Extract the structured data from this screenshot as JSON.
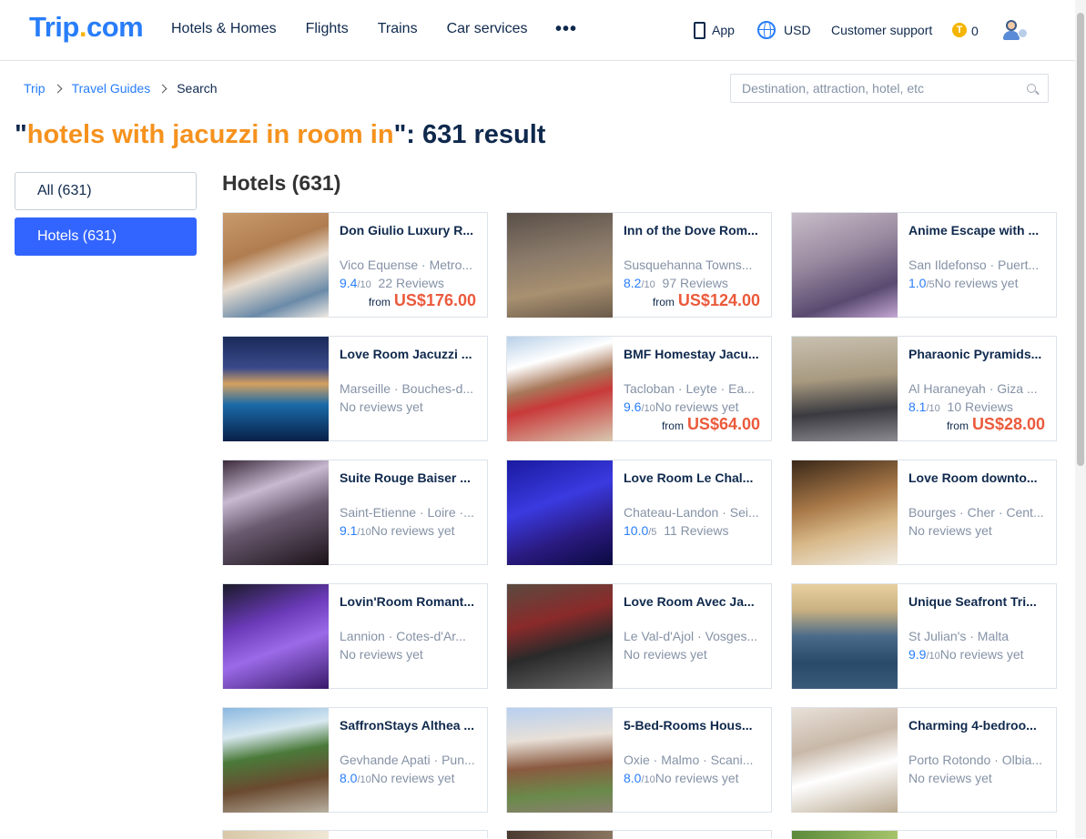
{
  "header": {
    "logo": {
      "trip": "Trip",
      "dot": ".",
      "com": "com"
    },
    "nav": [
      "Hotels & Homes",
      "Flights",
      "Trains",
      "Car services"
    ],
    "more": "•••",
    "app": "App",
    "currency": "USD",
    "support": "Customer support",
    "coin_icon": "T",
    "coins": "0"
  },
  "breadcrumb": [
    "Trip",
    "Travel Guides",
    "Search"
  ],
  "search": {
    "placeholder": "Destination, attraction, hotel, etc"
  },
  "title": {
    "open_quote": "\"",
    "query": "hotels with jacuzzi in room in",
    "suffix": "\": 631 result"
  },
  "filters": [
    {
      "label": "All (631)",
      "active": false
    },
    {
      "label": "Hotels (631)",
      "active": true
    }
  ],
  "section_title": "Hotels (631)",
  "colors": {
    "accent": "#287dfa",
    "query": "#f5921e",
    "price": "#eb5a3c",
    "active_filter": "#3264ff"
  },
  "hotels": [
    {
      "name": "Don Giulio Luxury R...",
      "location": "Vico Equense · Metro...",
      "score": "9.4",
      "out_of": "/10",
      "reviews": "22 Reviews",
      "from": "from",
      "price": "US$176.00"
    },
    {
      "name": "Inn of the Dove Rom...",
      "location": "Susquehanna Towns...",
      "score": "8.2",
      "out_of": "/10",
      "reviews": "97 Reviews",
      "from": "from",
      "price": "US$124.00"
    },
    {
      "name": "Anime Escape with ...",
      "location": "San Ildefonso · Puert...",
      "score": "1.0",
      "out_of": "/5",
      "reviews": "No reviews yet",
      "from": "",
      "price": ""
    },
    {
      "name": "Love Room Jacuzzi ...",
      "location": "Marseille · Bouches-d...",
      "score": "",
      "out_of": "",
      "reviews": "No reviews yet",
      "from": "",
      "price": ""
    },
    {
      "name": "BMF Homestay Jacu...",
      "location": "Tacloban · Leyte · Ea...",
      "score": "9.6",
      "out_of": "/10",
      "reviews": "No reviews yet",
      "from": "from",
      "price": "US$64.00"
    },
    {
      "name": "Pharaonic Pyramids...",
      "location": "Al Haraneyah · Giza ...",
      "score": "8.1",
      "out_of": "/10",
      "reviews": "10 Reviews",
      "from": "from",
      "price": "US$28.00"
    },
    {
      "name": "Suite Rouge Baiser ...",
      "location": "Saint-Etienne · Loire ·...",
      "score": "9.1",
      "out_of": "/10",
      "reviews": "No reviews yet",
      "from": "",
      "price": ""
    },
    {
      "name": "Love Room Le Chal...",
      "location": "Chateau-Landon · Sei...",
      "score": "10.0",
      "out_of": "/5",
      "reviews": "11 Reviews",
      "from": "",
      "price": ""
    },
    {
      "name": "Love Room downto...",
      "location": "Bourges · Cher · Cent...",
      "score": "",
      "out_of": "",
      "reviews": "No reviews yet",
      "from": "",
      "price": ""
    },
    {
      "name": "Lovin'Room Romant...",
      "location": "Lannion · Cotes-d'Ar...",
      "score": "",
      "out_of": "",
      "reviews": "No reviews yet",
      "from": "",
      "price": ""
    },
    {
      "name": "Love Room Avec Ja...",
      "location": "Le Val-d'Ajol · Vosges...",
      "score": "",
      "out_of": "",
      "reviews": "No reviews yet",
      "from": "",
      "price": ""
    },
    {
      "name": "Unique Seafront Tri...",
      "location": "St Julian's · Malta",
      "score": "9.9",
      "out_of": "/10",
      "reviews": "No reviews yet",
      "from": "",
      "price": ""
    },
    {
      "name": "SaffronStays Althea ...",
      "location": "Gevhande Apati · Pun...",
      "score": "8.0",
      "out_of": "/10",
      "reviews": "No reviews yet",
      "from": "",
      "price": ""
    },
    {
      "name": "5-Bed-Rooms Hous...",
      "location": "Oxie · Malmo · Scani...",
      "score": "8.0",
      "out_of": "/10",
      "reviews": "No reviews yet",
      "from": "",
      "price": ""
    },
    {
      "name": "Charming 4-bedroo...",
      "location": "Porto Rotondo · Olbia...",
      "score": "",
      "out_of": "",
      "reviews": "No reviews yet",
      "from": "",
      "price": ""
    }
  ]
}
